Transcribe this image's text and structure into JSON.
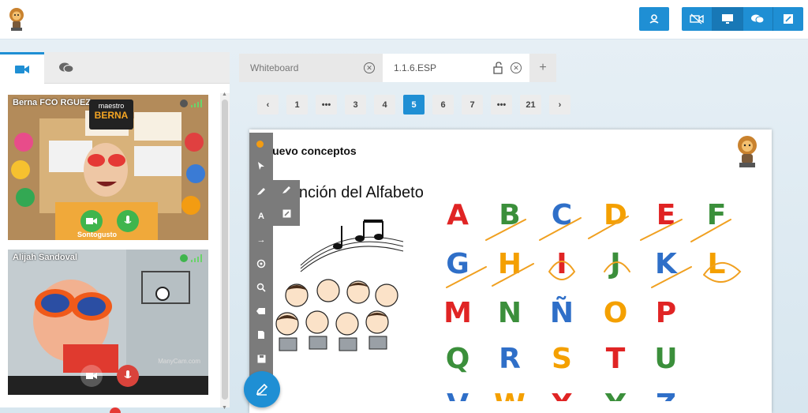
{
  "topbar": {
    "icons": [
      "app-logo",
      "lion-mascot-icon",
      "video-off-icon",
      "screen-share-icon",
      "chat-icon",
      "edit-icon"
    ]
  },
  "left_panel": {
    "tabs": [
      {
        "name": "video-tab",
        "icon": "video-camera-icon"
      },
      {
        "name": "chat-tab",
        "icon": "chat-bubble-icon"
      }
    ],
    "participants": [
      {
        "name": "Berna FCO RGUEZ",
        "status_color": "#555555",
        "overlay_labels": [
          "maestro",
          "BERNA",
          "Sontogusto"
        ]
      },
      {
        "name": "Alijah Sandoval",
        "status_color": "#3fb54d",
        "watermark": "ManyCam.com"
      }
    ]
  },
  "tabs": [
    {
      "label": "Whiteboard"
    },
    {
      "label": "1.1.6.ESP"
    }
  ],
  "pager": {
    "items": [
      "3",
      "4",
      "5",
      "6",
      "7"
    ],
    "first": "1",
    "last": "21",
    "ellipsis": "•••",
    "current": "5"
  },
  "board": {
    "title": "Nuevo conceptos",
    "song_title": "La canción del Alfabeto"
  },
  "colors": {
    "accent": "#1f8fd4",
    "red": "#e02424",
    "green": "#3b8f3b",
    "blue": "#2f6fc8",
    "orange": "#f4a000",
    "annotation": "#f0a020"
  },
  "chart_data": {
    "type": "table",
    "letters": [
      {
        "ch": "A",
        "color": "#e02424"
      },
      {
        "ch": "B",
        "color": "#3b8f3b"
      },
      {
        "ch": "C",
        "color": "#2f6fc8"
      },
      {
        "ch": "D",
        "color": "#f4a000"
      },
      {
        "ch": "E",
        "color": "#e02424"
      },
      {
        "ch": "F",
        "color": "#3b8f3b"
      },
      {
        "ch": "G",
        "color": "#2f6fc8"
      },
      {
        "ch": "H",
        "color": "#f4a000"
      },
      {
        "ch": "I",
        "color": "#e02424"
      },
      {
        "ch": "J",
        "color": "#3b8f3b"
      },
      {
        "ch": "K",
        "color": "#2f6fc8"
      },
      {
        "ch": "L",
        "color": "#f4a000"
      },
      {
        "ch": "M",
        "color": "#e02424"
      },
      {
        "ch": "N",
        "color": "#3b8f3b"
      },
      {
        "ch": "Ñ",
        "color": "#2f6fc8"
      },
      {
        "ch": "O",
        "color": "#f4a000"
      },
      {
        "ch": "P",
        "color": "#e02424"
      },
      {
        "ch": "Q",
        "color": "#3b8f3b"
      },
      {
        "ch": "R",
        "color": "#2f6fc8"
      },
      {
        "ch": "S",
        "color": "#f4a000"
      },
      {
        "ch": "T",
        "color": "#e02424"
      },
      {
        "ch": "U",
        "color": "#3b8f3b"
      },
      {
        "ch": "V",
        "color": "#2f6fc8"
      },
      {
        "ch": "W",
        "color": "#f4a000"
      },
      {
        "ch": "X",
        "color": "#e02424"
      },
      {
        "ch": "Y",
        "color": "#3b8f3b"
      },
      {
        "ch": "Z",
        "color": "#2f6fc8"
      }
    ]
  }
}
